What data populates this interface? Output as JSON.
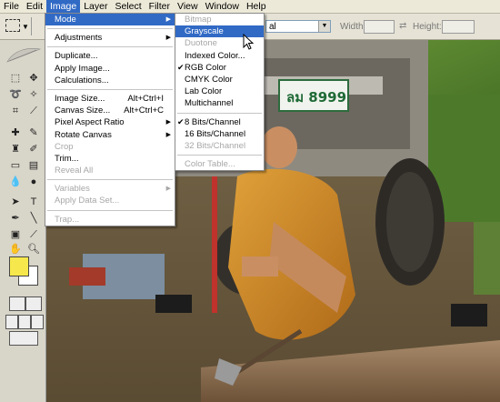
{
  "menubar": {
    "items": [
      "File",
      "Edit",
      "Image",
      "Layer",
      "Select",
      "Filter",
      "View",
      "Window",
      "Help"
    ],
    "active": "Image"
  },
  "options_bar": {
    "style_value": "al",
    "width_label": "Width:",
    "height_label": "Height:"
  },
  "photo": {
    "license_plate": "ลม 8999"
  },
  "image_menu": [
    {
      "label": "Mode",
      "submenu": true,
      "state": "highlighted"
    },
    {
      "divider": true
    },
    {
      "label": "Adjustments",
      "submenu": true
    },
    {
      "divider": true
    },
    {
      "label": "Duplicate..."
    },
    {
      "label": "Apply Image..."
    },
    {
      "label": "Calculations..."
    },
    {
      "divider": true
    },
    {
      "label": "Image Size...",
      "shortcut": "Alt+Ctrl+I"
    },
    {
      "label": "Canvas Size...",
      "shortcut": "Alt+Ctrl+C"
    },
    {
      "label": "Pixel Aspect Ratio",
      "submenu": true
    },
    {
      "label": "Rotate Canvas",
      "submenu": true
    },
    {
      "label": "Crop",
      "disabled": true
    },
    {
      "label": "Trim..."
    },
    {
      "label": "Reveal All",
      "disabled": true
    },
    {
      "divider": true
    },
    {
      "label": "Variables",
      "submenu": true,
      "disabled": true
    },
    {
      "label": "Apply Data Set...",
      "disabled": true
    },
    {
      "divider": true
    },
    {
      "label": "Trap...",
      "disabled": true
    }
  ],
  "mode_menu": [
    {
      "label": "Bitmap",
      "disabled": true
    },
    {
      "label": "Grayscale",
      "state": "highlighted"
    },
    {
      "label": "Duotone",
      "disabled": true
    },
    {
      "label": "Indexed Color..."
    },
    {
      "label": "RGB Color",
      "checked": true
    },
    {
      "label": "CMYK Color"
    },
    {
      "label": "Lab Color"
    },
    {
      "label": "Multichannel"
    },
    {
      "divider": true
    },
    {
      "label": "8 Bits/Channel",
      "checked": true
    },
    {
      "label": "16 Bits/Channel"
    },
    {
      "label": "32 Bits/Channel",
      "disabled": true
    },
    {
      "divider": true
    },
    {
      "label": "Color Table...",
      "disabled": true
    }
  ],
  "colors": {
    "foreground": "#f6e84c",
    "background": "#ffffff",
    "highlight": "#316ac5"
  }
}
